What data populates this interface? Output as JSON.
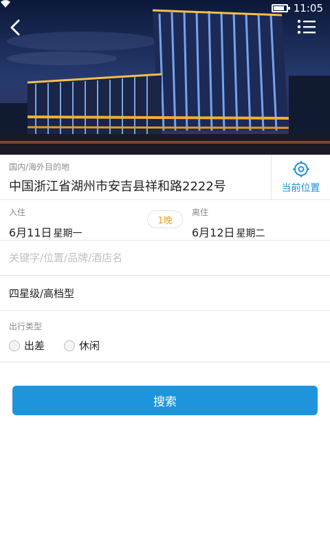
{
  "status_bar": {
    "time": "11:05",
    "icons": [
      "wifi-icon",
      "battery-icon"
    ],
    "battery_level": 0.85
  },
  "header": {
    "back_icon": "chevron-left-icon",
    "menu_icon": "list-menu-icon"
  },
  "destination": {
    "label": "国内/海外目的地",
    "value": "中国浙江省湖州市安吉县祥和路2222号",
    "locate_icon": "crosshair-icon",
    "locate_label": "当前位置"
  },
  "dates": {
    "checkin_label": "入住",
    "checkin_date": "6月11日",
    "checkin_weekday": "星期一",
    "nights": "1晚",
    "checkout_label": "离住",
    "checkout_date": "6月12日",
    "checkout_weekday": "星期二"
  },
  "keyword": {
    "placeholder": "关键字/位置/品牌/酒店名",
    "value": ""
  },
  "star": {
    "value": "四星级/高档型"
  },
  "trip_type": {
    "label": "出行类型",
    "options": [
      "出差",
      "休闲"
    ]
  },
  "search_button": {
    "label": "搜索"
  },
  "colors": {
    "accent": "#1e94dd",
    "locate": "#1e8fdc",
    "nights_badge": "#f0a020"
  }
}
